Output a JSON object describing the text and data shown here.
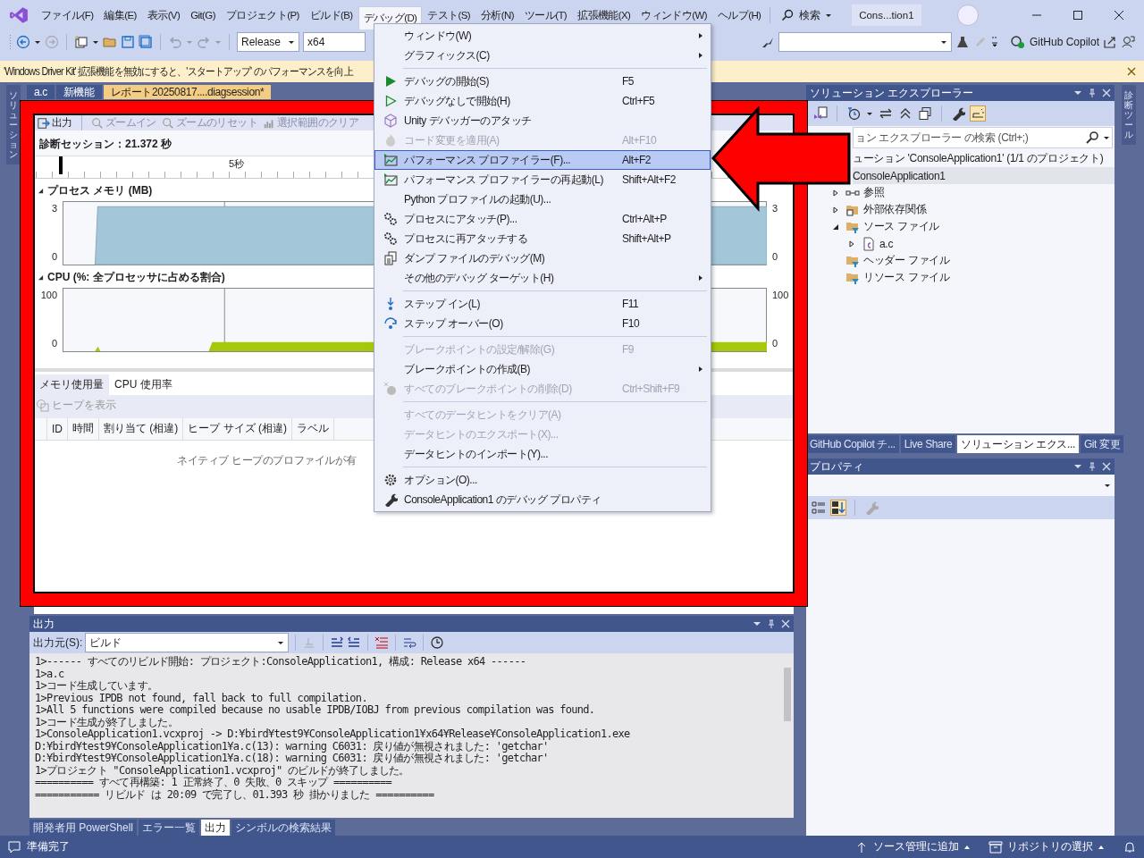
{
  "menu_bar": {
    "items": [
      {
        "label": "ファイル(F)",
        "selected": false
      },
      {
        "label": "編集(E)",
        "selected": false
      },
      {
        "label": "表示(V)",
        "selected": false
      },
      {
        "label": "Git(G)",
        "selected": false
      },
      {
        "label": "プロジェクト(P)",
        "selected": false
      },
      {
        "label": "ビルド(B)",
        "selected": false
      },
      {
        "label": "デバッグ(D)",
        "selected": true
      },
      {
        "label": "テスト(S)",
        "selected": false
      },
      {
        "label": "分析(N)",
        "selected": false
      },
      {
        "label": "ツール(T)",
        "selected": false
      },
      {
        "label": "拡張機能(X)",
        "selected": false
      },
      {
        "label": "ウィンドウ(W)",
        "selected": false
      },
      {
        "label": "ヘルプ(H)",
        "selected": false
      }
    ],
    "search": "検索",
    "title": "Cons...tion1"
  },
  "toolbar": {
    "configuration": "Release",
    "platform": "x64",
    "copilot": "GitHub Copilot"
  },
  "info_bar": {
    "message": "'Windows Driver Kit' 拡張機能を無効にすると、'スタートアップ' のパフォーマンスを向上"
  },
  "left_strip": {
    "tab": "ソリューション"
  },
  "right_strip": {
    "tab": "診断ツール"
  },
  "document_tabs": [
    {
      "label": "a.c",
      "selected": false
    },
    {
      "label": "新機能",
      "selected": false
    },
    {
      "label": "レポート20250817....diagsession*",
      "selected": true
    }
  ],
  "diagnostics": {
    "toolbar": [
      {
        "label": "出力",
        "disabled": false
      },
      {
        "label": "ズームイン",
        "disabled": true
      },
      {
        "label": "ズームのリセット",
        "disabled": true
      },
      {
        "label": "選択範囲のクリア",
        "disabled": true
      }
    ],
    "session": "診断セッション：21.372 秒",
    "ruler_label": "5秒",
    "charts": [
      {
        "title": "プロセス メモリ (MB)",
        "kind": "memory",
        "max": "3",
        "min": "0",
        "right_max": "3",
        "right_min": "0"
      },
      {
        "title": "CPU (%: 全プロセッサに占める割合)",
        "kind": "cpu",
        "max": "100",
        "min": "0",
        "right_max": "100",
        "right_min": "0"
      }
    ],
    "tabs": [
      {
        "label": "メモリ使用量",
        "selected": true
      },
      {
        "label": "CPU 使用率",
        "selected": false
      }
    ],
    "heap_button": "ヒープを表示",
    "columns": [
      "ID",
      "時間",
      "割り当て (相違)",
      "ヒープ サイズ (相違)",
      "ラベル"
    ],
    "empty_message": "ネイティブ ヒープのプロファイルが有"
  },
  "debug_menu": {
    "groups": [
      [
        {
          "label": "ウィンドウ(W)",
          "disabled": false,
          "selected": false,
          "submenu": true
        },
        {
          "label": "グラフィックス(C)",
          "disabled": false,
          "selected": false,
          "submenu": true
        }
      ],
      [
        {
          "label": "デバッグの開始(S)",
          "shortcut": "F5",
          "disabled": false,
          "selected": false,
          "submenu": false
        },
        {
          "label": "デバッグなしで開始(H)",
          "shortcut": "Ctrl+F5",
          "disabled": false,
          "selected": false,
          "submenu": false
        },
        {
          "label": "Unity デバッガーのアタッチ",
          "disabled": false,
          "selected": false,
          "submenu": false
        },
        {
          "label": "コード変更を適用(A)",
          "shortcut": "Alt+F10",
          "disabled": true,
          "selected": false,
          "submenu": false
        },
        {
          "label": "パフォーマンス プロファイラー(F)...",
          "shortcut": "Alt+F2",
          "disabled": false,
          "selected": true,
          "submenu": false
        },
        {
          "label": "パフォーマンス プロファイラーの再起動(L)",
          "shortcut": "Shift+Alt+F2",
          "disabled": false,
          "selected": false,
          "submenu": false
        },
        {
          "label": "Python プロファイルの起動(U)...",
          "disabled": false,
          "selected": false,
          "submenu": false
        },
        {
          "label": "プロセスにアタッチ(P)...",
          "shortcut": "Ctrl+Alt+P",
          "disabled": false,
          "selected": false,
          "submenu": false
        },
        {
          "label": "プロセスに再アタッチする",
          "shortcut": "Shift+Alt+P",
          "disabled": false,
          "selected": false,
          "submenu": false
        },
        {
          "label": "ダンプ ファイルのデバッグ(M)",
          "disabled": false,
          "selected": false,
          "submenu": false
        },
        {
          "label": "その他のデバッグ ターゲット(H)",
          "disabled": false,
          "selected": false,
          "submenu": true
        }
      ],
      [
        {
          "label": "ステップ イン(L)",
          "shortcut": "F11",
          "disabled": false,
          "selected": false,
          "submenu": false
        },
        {
          "label": "ステップ オーバー(O)",
          "shortcut": "F10",
          "disabled": false,
          "selected": false,
          "submenu": false
        }
      ],
      [
        {
          "label": "ブレークポイントの設定/解除(G)",
          "shortcut": "F9",
          "disabled": true,
          "selected": false,
          "submenu": false
        },
        {
          "label": "ブレークポイントの作成(B)",
          "disabled": false,
          "selected": false,
          "submenu": true
        },
        {
          "label": "すべてのブレークポイントの削除(D)",
          "shortcut": "Ctrl+Shift+F9",
          "disabled": true,
          "selected": false,
          "submenu": false
        }
      ],
      [
        {
          "label": "すべてのデータヒントをクリア(A)",
          "disabled": true,
          "selected": false,
          "submenu": false
        },
        {
          "label": "データヒントのエクスポート(X)...",
          "disabled": true,
          "selected": false,
          "submenu": false
        },
        {
          "label": "データヒントのインポート(Y)...",
          "disabled": false,
          "selected": false,
          "submenu": false
        }
      ],
      [
        {
          "label": "オプション(O)...",
          "disabled": false,
          "selected": false,
          "submenu": false
        },
        {
          "label": "ConsoleApplication1 のデバッグ プロパティ",
          "disabled": false,
          "selected": false,
          "submenu": false
        }
      ]
    ]
  },
  "output": {
    "title": "出力",
    "source_label": "出力元(S):",
    "source": "ビルド",
    "lines": [
      "1>------ すべてのリビルド開始: プロジェクト:ConsoleApplication1, 構成: Release x64 ------",
      "1>a.c",
      "1>コード生成しています。",
      "1>Previous IPDB not found, fall back to full compilation.",
      "1>All 5 functions were compiled because no usable IPDB/IOBJ from previous compilation was found.",
      "1>コード生成が終了しました。",
      "1>ConsoleApplication1.vcxproj -> D:¥bird¥test9¥ConsoleApplication1¥x64¥Release¥ConsoleApplication1.exe",
      "D:¥bird¥test9¥ConsoleApplication1¥a.c(13): warning C6031: 戻り値が無視されました: 'getchar'",
      "D:¥bird¥test9¥ConsoleApplication1¥a.c(18): warning C6031: 戻り値が無視されました: 'getchar'",
      "1>プロジェクト \"ConsoleApplication1.vcxproj\" のビルドが終了しました。",
      "========== すべて再構築: 1 正常終了、0 失敗、0 スキップ ==========",
      "=========== リビルド は 20:09 で完了し、01.393 秒 掛かりました =========="
    ],
    "tabs": [
      {
        "label": "開発者用 PowerShell",
        "selected": false
      },
      {
        "label": "エラー一覧",
        "selected": false
      },
      {
        "label": "出力",
        "selected": true
      },
      {
        "label": "シンボルの検索結果",
        "selected": false
      }
    ]
  },
  "solution_explorer": {
    "title": "ソリューション エクスプローラー",
    "search_placeholder": "ョン エクスプローラー の検索 (Ctrl+;)",
    "tree": [
      {
        "label": "ューション 'ConsoleApplication1' (1/1 のプロジェクト)",
        "kind": "solution",
        "selected": false,
        "children": [
          {
            "label": "ConsoleApplication1",
            "kind": "project",
            "selected": true,
            "children": [
              {
                "label": "参照",
                "kind": "references",
                "expanded": false,
                "selected": false
              },
              {
                "label": "外部依存関係",
                "kind": "dependencies",
                "expanded": false,
                "selected": false
              },
              {
                "label": "ソース ファイル",
                "kind": "filter",
                "expanded": true,
                "selected": false,
                "children": [
                  {
                    "label": "a.c",
                    "kind": "file",
                    "expanded": false,
                    "selected": false
                  }
                ]
              },
              {
                "label": "ヘッダー ファイル",
                "kind": "filter",
                "selected": false
              },
              {
                "label": "リソース ファイル",
                "kind": "filter",
                "selected": false
              }
            ]
          }
        ]
      }
    ],
    "tabs": [
      {
        "label": "GitHub Copilot チ...",
        "selected": false
      },
      {
        "label": "Live Share",
        "selected": false
      },
      {
        "label": "ソリューション エクス...",
        "selected": true
      },
      {
        "label": "Git 変更",
        "selected": false
      }
    ]
  },
  "properties": {
    "title": "プロパティ"
  },
  "status_bar": {
    "message": "準備完了",
    "source_control": "ソース管理に追加",
    "repository": "リポジトリの選択"
  }
}
